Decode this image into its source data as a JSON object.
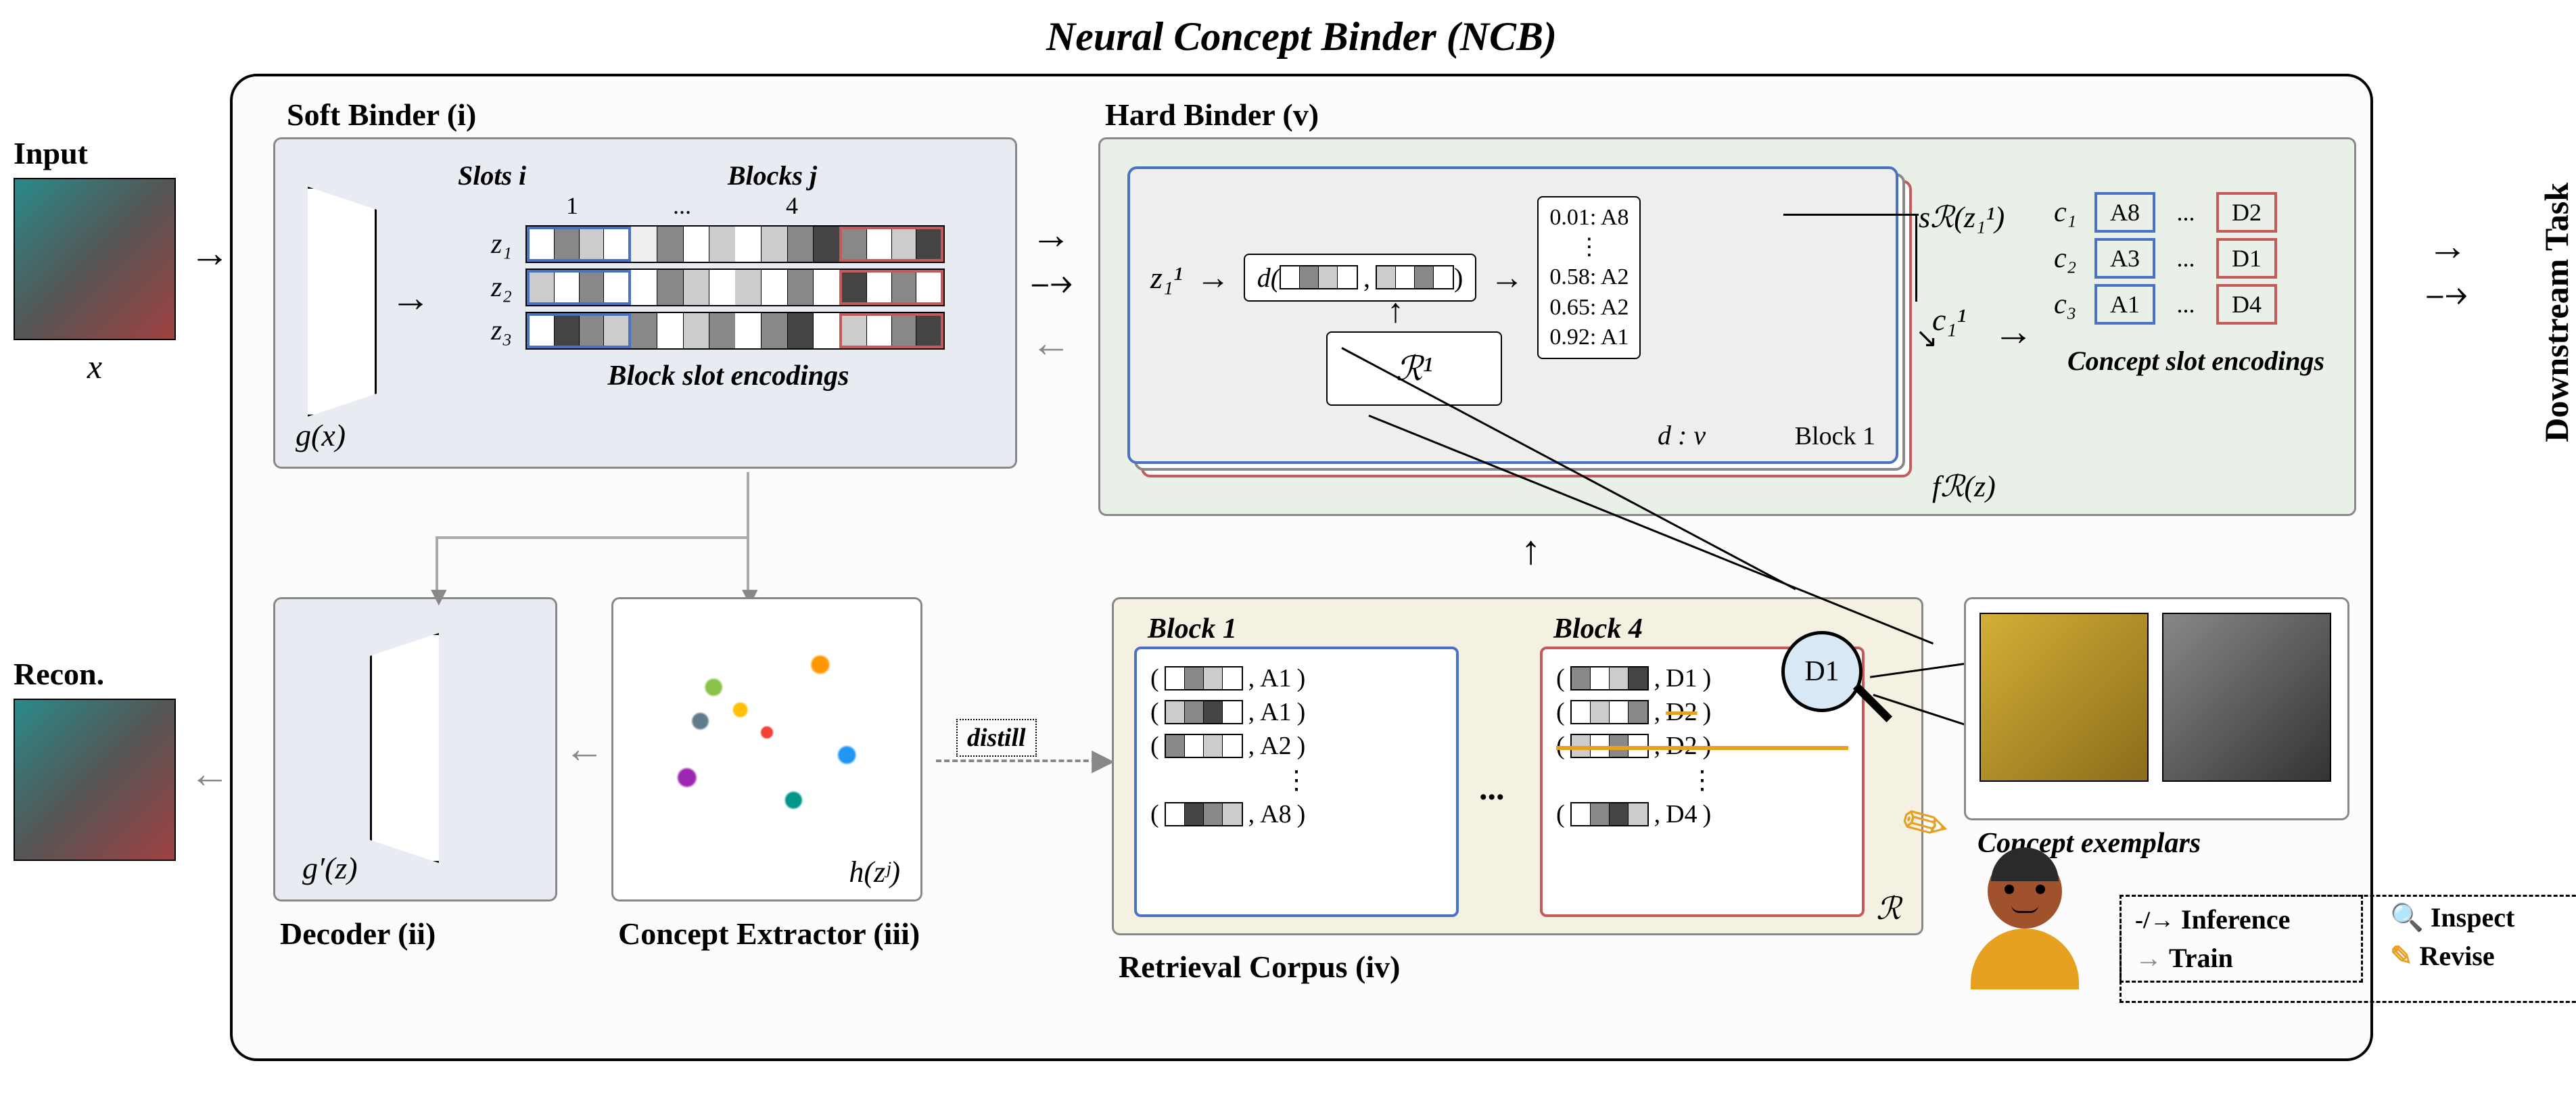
{
  "title": "Neural Concept Binder (NCB)",
  "inputLabel": "Input",
  "inputVar": "x",
  "reconLabel": "Recon.",
  "downstreamLabel": "Downstream Task",
  "softBinder": {
    "label": "Soft Binder (i)",
    "func": "g(x)",
    "slotsHeader": "Slots i",
    "blocksHeader": "Blocks j",
    "blockNums": [
      "1",
      "...",
      "4"
    ],
    "slotVars": [
      "z₁",
      "z₂",
      "z₃"
    ],
    "caption": "Block slot encodings"
  },
  "hardBinder": {
    "label": "Hard Binder (v)",
    "inputVar": "z₁¹",
    "dFunc": "d(",
    "dFuncEnd": ")",
    "R1": "ℛ¹",
    "scores": [
      "0.01: A8",
      "⋮",
      "0.58: A2",
      "0.65: A2",
      "0.92: A1"
    ],
    "dv": "d : v",
    "blockLabel": "Block 1",
    "sFunc": "sℛ(z₁¹)",
    "cVar": "c₁¹",
    "fFunc": "fℛ(z)",
    "conceptTable": {
      "rows": [
        "c₁",
        "c₂",
        "c₃"
      ],
      "cells": [
        [
          "A8",
          "...",
          "D2"
        ],
        [
          "A3",
          "...",
          "D1"
        ],
        [
          "A1",
          "...",
          "D4"
        ]
      ]
    },
    "caption": "Concept slot encodings"
  },
  "decoder": {
    "label": "Decoder (ii)",
    "func": "g′(z)"
  },
  "extractor": {
    "label": "Concept Extractor (iii)",
    "func": "h(zʲ)"
  },
  "corpus": {
    "label": "Retrieval Corpus (iv)",
    "block1": "Block 1",
    "block4": "Block 4",
    "distill": "distill",
    "items1": [
      "A1",
      "A1",
      "A2",
      "⋮",
      "A8"
    ],
    "items4": [
      "D1",
      "D2",
      "D2",
      "⋮",
      "D4"
    ],
    "Rsym": "ℛ"
  },
  "exemplars": {
    "label": "Concept exemplars",
    "magnify": "D1"
  },
  "legend": {
    "inference": "Inference",
    "train": "Train",
    "inspect": "Inspect",
    "revise": "Revise"
  }
}
